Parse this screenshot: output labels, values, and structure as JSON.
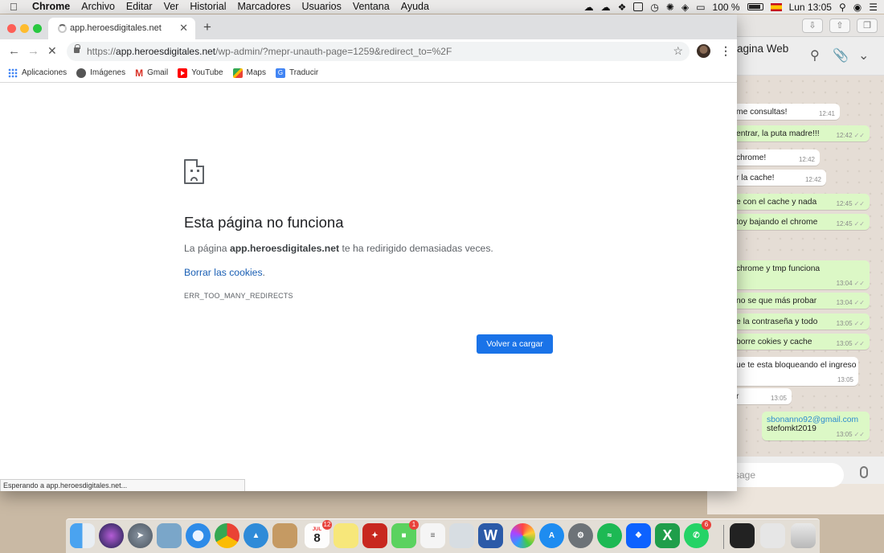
{
  "menubar": {
    "app": "Chrome",
    "items": [
      "Archivo",
      "Editar",
      "Ver",
      "Historial",
      "Marcadores",
      "Usuarios",
      "Ventana",
      "Ayuda"
    ],
    "battery": "100 %",
    "clock": "Lun 13:05"
  },
  "chrome": {
    "tab_title": "app.heroesdigitales.net",
    "new_tab": "+",
    "url_prefix": "https://",
    "url_host": "app.heroesdigitales.net",
    "url_path": "/wp-admin/?mepr-unauth-page=1259&redirect_to=%2F",
    "bookmarks": [
      {
        "label": "Aplicaciones",
        "icon": "apps-grid-icon"
      },
      {
        "label": "Imágenes",
        "icon": "images-icon"
      },
      {
        "label": "Gmail",
        "icon": "gmail-icon"
      },
      {
        "label": "YouTube",
        "icon": "youtube-icon"
      },
      {
        "label": "Maps",
        "icon": "maps-icon"
      },
      {
        "label": "Traducir",
        "icon": "translate-icon"
      }
    ],
    "error": {
      "title": "Esta página no funciona",
      "msg_pre": "La página ",
      "msg_host": "app.heroesdigitales.net",
      "msg_post": " te ha redirigido demasiadas veces.",
      "link": "Borrar las cookies",
      "link_dot": ".",
      "code": "ERR_TOO_MANY_REDIRECTS",
      "button": "Volver a cargar"
    },
    "status": "Esperando a app.heroesdigitales.net..."
  },
  "whatsapp": {
    "title": "agina Web",
    "input_placeholder": "ssage",
    "messages": [
      {
        "text": "me consultas!",
        "time": "12:41",
        "dir": "in"
      },
      {
        "text": "entrar, la puta madre!!!",
        "time": "12:42",
        "dir": "out"
      },
      {
        "text": "chrome!",
        "time": "12:42",
        "dir": "in"
      },
      {
        "text": "r la cache!",
        "time": "12:42",
        "dir": "in"
      },
      {
        "text": "e con el cache y nada",
        "time": "12:45",
        "dir": "out"
      },
      {
        "text": "toy bajando el chrome",
        "time": "12:45",
        "dir": "out"
      },
      {
        "text": "chrome y tmp funciona",
        "time": "13:04",
        "dir": "out"
      },
      {
        "text": "no se que más probar",
        "time": "13:04",
        "dir": "out"
      },
      {
        "text": "e la contraseña y todo",
        "time": "13:05",
        "dir": "out"
      },
      {
        "text": "borre cokies y cache",
        "time": "13:05",
        "dir": "out"
      },
      {
        "text": "ue te esta bloqueando el ingreso",
        "time": "13:05",
        "dir": "in"
      },
      {
        "text": "r",
        "time": "13:05",
        "dir": "in"
      },
      {
        "text": "sbonanno92@gmail.com",
        "text2": "stefomkt2019",
        "time": "13:05",
        "dir": "out"
      }
    ]
  },
  "dock": {
    "calendar_month": "JUL",
    "calendar_day": "8",
    "calendar_badge": "12",
    "facetime_badge": "1",
    "whatsapp_badge": "6"
  },
  "colors": {
    "accent": "#1a73e8",
    "link": "#1a5fb4",
    "wa_out": "#dcf8c6"
  }
}
